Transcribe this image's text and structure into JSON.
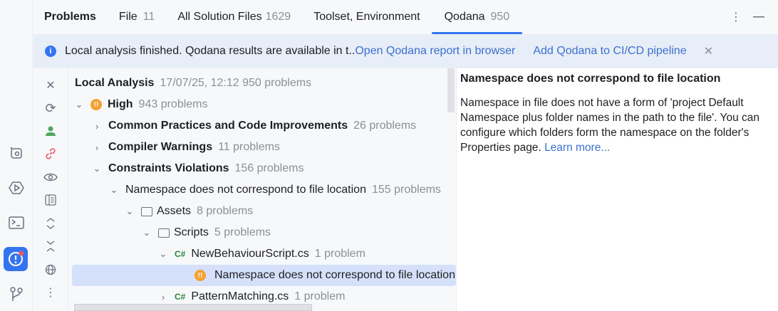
{
  "header": {
    "title": "Problems",
    "tabs": [
      {
        "label": "File",
        "count": "11"
      },
      {
        "label": "All Solution Files",
        "count": "1629"
      },
      {
        "label": "Toolset, Environment",
        "count": ""
      },
      {
        "label": "Qodana",
        "count": "950"
      }
    ]
  },
  "banner": {
    "message": "Local analysis finished. Qodana results are available in t..",
    "link1": "Open Qodana report in browser",
    "link2": "Add Qodana to CI/CD pipeline"
  },
  "tree": {
    "root": {
      "label": "Local Analysis",
      "meta": "17/07/25, 12:12  950 problems"
    },
    "rows": [
      {
        "label": "High",
        "count": "943 problems"
      },
      {
        "label": "Common Practices and Code Improvements",
        "count": "26 problems"
      },
      {
        "label": "Compiler Warnings",
        "count": "11 problems"
      },
      {
        "label": "Constraints Violations",
        "count": "156 problems"
      },
      {
        "label": "Namespace does not correspond to file location",
        "count": "155 problems"
      },
      {
        "label": "Assets",
        "count": "8 problems"
      },
      {
        "label": "Scripts",
        "count": "5 problems"
      },
      {
        "label": "NewBehaviourScript.cs",
        "count": "1 problem",
        "lang": "C#"
      },
      {
        "label": "Namespace does not correspond to file location",
        "count": ""
      },
      {
        "label": "PatternMatching.cs",
        "count": "1 problem",
        "lang": "C#"
      }
    ]
  },
  "details": {
    "title": "Namespace does not correspond to file location",
    "body": "Namespace in file does not have a form of 'project Default Namespace plus folder names in the path to the file'. You can configure which folders form the namespace on the folder's Properties page.",
    "link": "Learn more..."
  },
  "colors": {
    "accent": "#3574f0",
    "warning": "#f5a031",
    "selection": "#d5e1fb",
    "banner": "#e8eef7"
  }
}
